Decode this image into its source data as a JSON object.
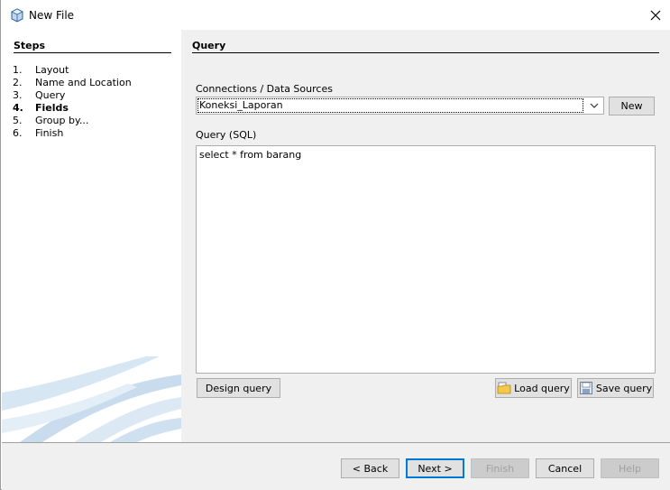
{
  "window": {
    "title": "New File"
  },
  "steps": {
    "heading": "Steps",
    "items": [
      {
        "num": "1.",
        "label": "Layout",
        "current": false
      },
      {
        "num": "2.",
        "label": "Name and Location",
        "current": false
      },
      {
        "num": "3.",
        "label": "Query",
        "current": false
      },
      {
        "num": "4.",
        "label": "Fields",
        "current": true
      },
      {
        "num": "5.",
        "label": "Group by...",
        "current": false
      },
      {
        "num": "6.",
        "label": "Finish",
        "current": false
      }
    ]
  },
  "content": {
    "heading": "Query",
    "connections_label": "Connections / Data Sources",
    "connection_value": "Koneksi_Laporan",
    "new_button": "New",
    "query_label": "Query (SQL)",
    "query_text": "select * from barang",
    "design_query": "Design query",
    "load_query": "Load query",
    "save_query": "Save query"
  },
  "footer": {
    "back": "< Back",
    "next": "Next >",
    "finish": "Finish",
    "cancel": "Cancel",
    "help": "Help"
  },
  "colors": {
    "accent": "#0078d7",
    "panel": "#f0f0f0",
    "button": "#e1e1e1"
  },
  "icons": {
    "title": "netbeans-cube-icon",
    "close": "close-icon",
    "dropdown": "chevron-down-icon",
    "load": "folder-open-icon",
    "save": "save-disk-icon"
  }
}
